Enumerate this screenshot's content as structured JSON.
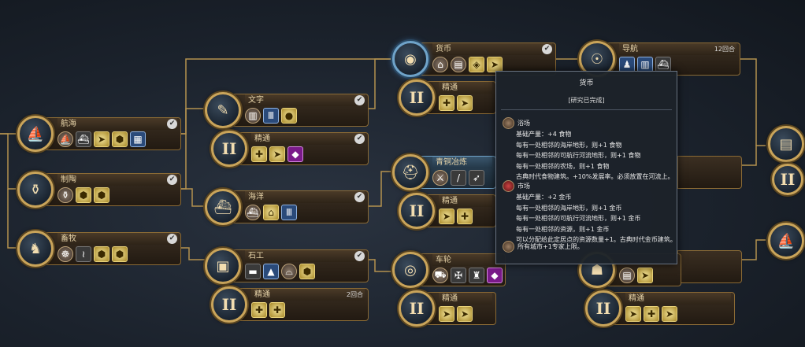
{
  "nodes": {
    "navigation": {
      "title": "航海",
      "icons": [
        "ship-icon",
        "boat-icon",
        "pointer-icon",
        "hex-icon",
        "map-icon"
      ]
    },
    "pottery": {
      "title": "制陶",
      "icons": [
        "pot-icon",
        "hex-icon",
        "hex-icon"
      ]
    },
    "animal_husbandry": {
      "title": "畜牧",
      "icons": [
        "scroll-icon",
        "trail-icon",
        "hex-icon",
        "hex-icon"
      ]
    },
    "writing": {
      "title": "文字",
      "icons": [
        "library-icon",
        "columns-icon",
        "bulb-icon"
      ]
    },
    "writing_mastery": {
      "title": "精通",
      "icons": [
        "plus-icon",
        "pointer-icon",
        "purple-icon"
      ]
    },
    "sailing": {
      "title": "海洋",
      "icons": [
        "boat-icon",
        "house-icon",
        "temple-icon"
      ]
    },
    "masonry": {
      "title": "石工",
      "icons": [
        "wall-icon",
        "obelisk-icon",
        "dome-icon",
        "hex-icon"
      ]
    },
    "masonry_mastery": {
      "title": "精通",
      "turns": "2回合",
      "icons": [
        "plus-icon",
        "plus-icon"
      ]
    },
    "currency": {
      "title": "货币",
      "icons": [
        "market-icon",
        "bank-icon",
        "wonder-icon",
        "pointer-icon"
      ]
    },
    "currency_mastery": {
      "title": "精通",
      "icons": [
        "plus-icon",
        "pointer-icon"
      ]
    },
    "bronze_working": {
      "title": "青铜冶炼",
      "icons": [
        "spear-icon",
        "sword-icon",
        "bow-icon"
      ]
    },
    "bronze_mastery": {
      "title": "精通",
      "icons": [
        "pointer-icon",
        "plus-icon"
      ]
    },
    "wheel": {
      "title": "车轮",
      "icons": [
        "cart-icon",
        "soldier-icon",
        "elephant-icon",
        "purple-icon"
      ]
    },
    "wheel_mastery": {
      "title": "精通",
      "icons": [
        "pointer-icon",
        "pointer-icon"
      ]
    },
    "astronomy": {
      "title": "导航",
      "turns": "12回合",
      "icons": [
        "blue-icon",
        "library-icon",
        "ship-icon"
      ]
    },
    "late_mastery": {
      "title": "精通",
      "icons": [
        "pointer-icon",
        "plus-icon",
        "pointer-icon"
      ]
    }
  },
  "mastery_numeral": "II",
  "tooltip": {
    "title": "货币",
    "status": "[研究已完成]",
    "sections": [
      {
        "name": "浴场",
        "lines": [
          "基础产量：+4 食物",
          "每有一处相邻的海岸地形，则+1 食物",
          "每有一处相邻的可航行河流地形，则+1 食物",
          "每有一处相邻的农场，则+1 食物",
          "古典时代食物建筑。+10%发展率。必须放置在河流上。"
        ]
      },
      {
        "name": "市场",
        "lines": [
          "基础产量：+2 金币",
          "每有一处相邻的海岸地形，则+1 金币",
          "每有一处相邻的可航行河流地形，则+1 金币",
          "每有一处相邻的资源，则+1 金币",
          "可以分配给此定居点的资源数量+1。古典时代金币建筑。"
        ]
      }
    ],
    "footer": "所有城市+1专家上限。"
  },
  "colors": {
    "gold": "#c9a45a",
    "food": "#7ec24a",
    "coin": "#e6c23a"
  }
}
